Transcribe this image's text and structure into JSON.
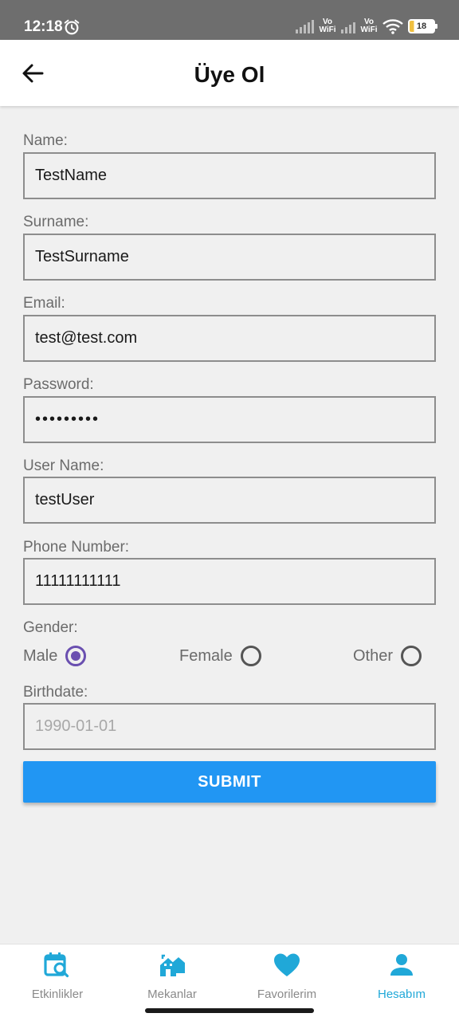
{
  "status_bar": {
    "time": "12:18",
    "vowifi_1": "Vo WiFi",
    "vowifi_2": "Vo WiFi",
    "battery": "18"
  },
  "header": {
    "title": "Üye Ol"
  },
  "form": {
    "name": {
      "label": "Name:",
      "value": "TestName"
    },
    "surname": {
      "label": "Surname:",
      "value": "TestSurname"
    },
    "email": {
      "label": "Email:",
      "value": "test@test.com"
    },
    "password": {
      "label": "Password:",
      "value": "•••••••••"
    },
    "username": {
      "label": "User Name:",
      "value": "testUser"
    },
    "phone": {
      "label": "Phone Number:",
      "value": "11111111111"
    },
    "gender": {
      "label": "Gender:",
      "options": [
        "Male",
        "Female",
        "Other"
      ],
      "selected": "Male"
    },
    "birthdate": {
      "label": "Birthdate:",
      "placeholder": "1990-01-01",
      "value": ""
    },
    "submit_label": "SUBMIT"
  },
  "bottom_nav": {
    "items": [
      {
        "label": "Etkinlikler",
        "icon": "calendar-search-icon",
        "active": false
      },
      {
        "label": "Mekanlar",
        "icon": "houses-icon",
        "active": false
      },
      {
        "label": "Favorilerim",
        "icon": "heart-icon",
        "active": false
      },
      {
        "label": "Hesabım",
        "icon": "person-icon",
        "active": true
      }
    ]
  },
  "colors": {
    "accent": "#2196f3",
    "nav_active": "#20a8d8",
    "radio_checked": "#6a4fb0"
  }
}
